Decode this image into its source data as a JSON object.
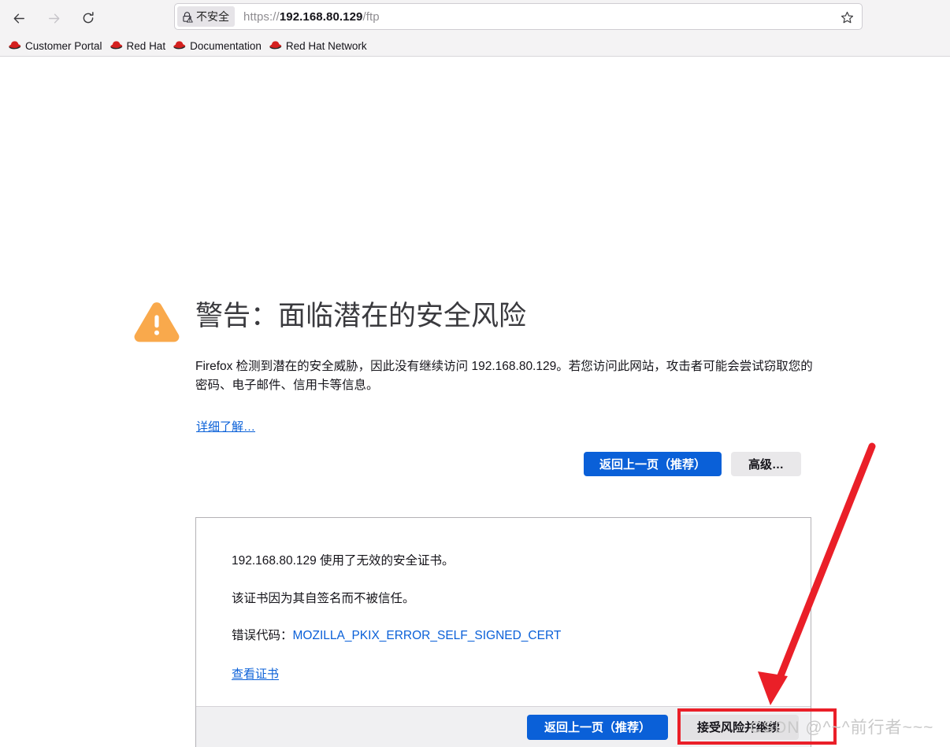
{
  "browser": {
    "nav": {
      "back_icon": "arrow-left-icon",
      "forward_icon": "arrow-right-icon",
      "reload_icon": "reload-icon"
    },
    "urlbar": {
      "identity_icon": "lock-warning-icon",
      "identity_label": "不安全",
      "url_scheme": "https://",
      "url_host": "192.168.80.129",
      "url_path": "/ftp",
      "url_full": "https://192.168.80.129/ftp",
      "bookmark_icon": "star-icon"
    },
    "bookmarks": [
      {
        "label": "Customer Portal",
        "icon": "redhat-fedora-icon"
      },
      {
        "label": "Red Hat",
        "icon": "redhat-fedora-icon"
      },
      {
        "label": "Documentation",
        "icon": "redhat-fedora-icon"
      },
      {
        "label": "Red Hat Network",
        "icon": "redhat-fedora-icon"
      }
    ]
  },
  "error_page": {
    "warning_icon": "warning-triangle-icon",
    "title": "警告：面临潜在的安全风险",
    "body": "Firefox 检测到潜在的安全威胁，因此没有继续访问 192.168.80.129。若您访问此网站，攻击者可能会尝试窃取您的密码、电子邮件、信用卡等信息。",
    "learn_more": "详细了解…",
    "buttons": {
      "go_back": "返回上一页（推荐）",
      "advanced": "高级…"
    },
    "cert_panel": {
      "line1": "192.168.80.129 使用了无效的安全证书。",
      "line2": "该证书因为其自签名而不被信任。",
      "error_code_label": "错误代码：",
      "error_code": "MOZILLA_PKIX_ERROR_SELF_SIGNED_CERT",
      "view_certificate": "查看证书",
      "footer_buttons": {
        "go_back": "返回上一页（推荐）",
        "accept_risk": "接受风险并继续"
      }
    }
  },
  "annotations": {
    "arrow_color": "#ea1f28",
    "highlight_target": "接受风险并继续",
    "watermark": "CSDN @^~^前行者~~~"
  },
  "colors": {
    "primary_button": "#0a60d8",
    "link": "#0a60d8",
    "warning_orange": "#f9a94c",
    "annotation_red": "#ea1f28"
  }
}
